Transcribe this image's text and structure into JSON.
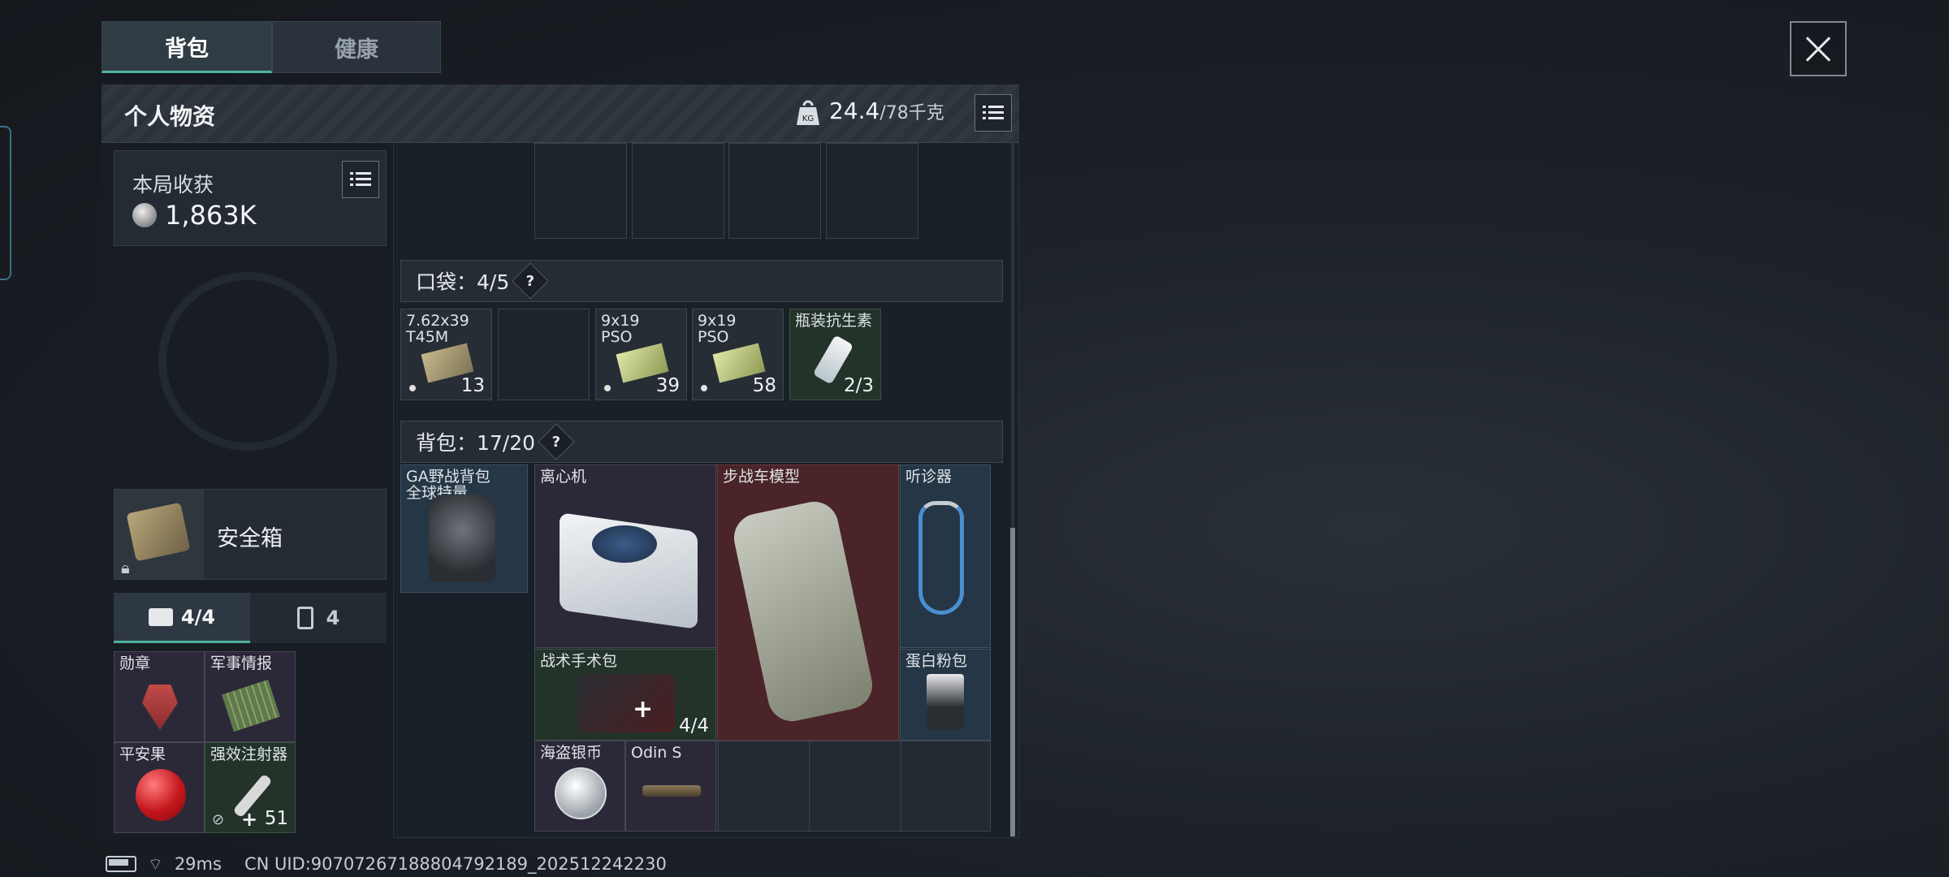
{
  "tabs": [
    {
      "label": "背包"
    },
    {
      "label": "健康"
    }
  ],
  "panel": {
    "title": "个人物资",
    "weight_current": "24.4",
    "weight_max": "/78千克"
  },
  "earnings": {
    "label": "本局收获",
    "value": "1,863K"
  },
  "safe_box": {
    "label": "安全箱"
  },
  "sub_tabs": [
    {
      "label": "4/4"
    },
    {
      "label": "4"
    }
  ],
  "special_items": [
    {
      "label": "勋章"
    },
    {
      "label": "军事情报"
    },
    {
      "label": "平安果"
    },
    {
      "label": "强效注射器",
      "count": "51"
    }
  ],
  "pockets": {
    "title": "口袋：4/5",
    "items": [
      {
        "line1": "7.62x39",
        "line2": "T45M",
        "count": "13"
      },
      {
        "line1": "",
        "line2": "",
        "count": ""
      },
      {
        "line1": "9x19",
        "line2": "PSO",
        "count": "39"
      },
      {
        "line1": "9x19",
        "line2": "PSO",
        "count": "58"
      },
      {
        "line1": "瓶装抗生素",
        "line2": "",
        "count": "2/3"
      }
    ]
  },
  "backpack": {
    "title": "背包：17/20",
    "equipped_line1": "GA野战背包",
    "equipped_line2": "全球特量",
    "items": {
      "centrifuge": "离心机",
      "ifv_model": "步战车模型",
      "stethoscope": "听诊器",
      "tactical_kit": "战术手术包",
      "tactical_kit_count": "4/4",
      "protein": "蛋白粉包",
      "pirate_coin": "海盗银币",
      "odin": "Odin S"
    }
  },
  "status_bar": {
    "ping": "29ms",
    "uid": "CN UID:90707267188804792189_202512242230"
  },
  "colors": {
    "accent": "#4fb3a0",
    "red_rarity": "#4a2428",
    "blue_rarity": "#253646",
    "green_rarity": "#23332a",
    "purple_rarity": "#2b2838"
  }
}
